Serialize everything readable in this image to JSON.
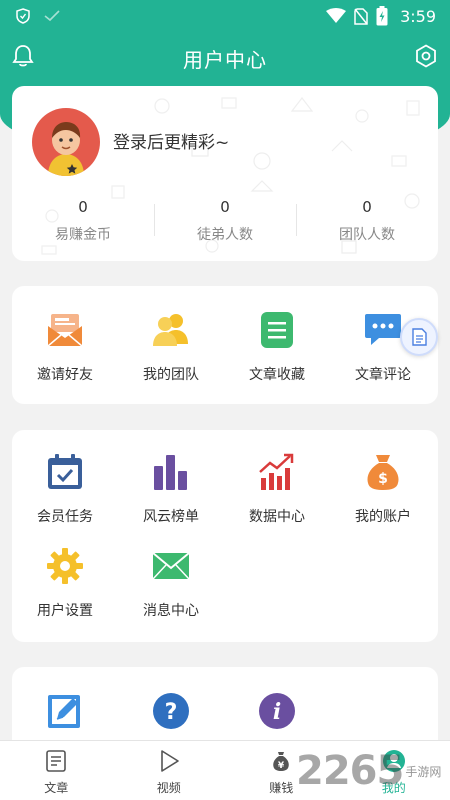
{
  "status_bar": {
    "time": "3:59",
    "icons": [
      "shield-icon",
      "check-icon",
      "wifi-icon",
      "no-sim-icon",
      "battery-charging-icon"
    ]
  },
  "header": {
    "title": "用户中心",
    "left_icon": "bell-icon",
    "right_icon": "settings-icon"
  },
  "profile": {
    "login_prompt": "登录后更精彩~",
    "stats": [
      {
        "value": "0",
        "label": "易赚金币"
      },
      {
        "value": "0",
        "label": "徒弟人数"
      },
      {
        "value": "0",
        "label": "团队人数"
      }
    ]
  },
  "menu_group_1": [
    {
      "label": "邀请好友",
      "icon": "invite-envelope-icon"
    },
    {
      "label": "我的团队",
      "icon": "team-icon"
    },
    {
      "label": "文章收藏",
      "icon": "collection-doc-icon"
    },
    {
      "label": "文章评论",
      "icon": "comment-icon"
    }
  ],
  "menu_group_2": [
    {
      "label": "会员任务",
      "icon": "calendar-task-icon"
    },
    {
      "label": "风云榜单",
      "icon": "ranking-bars-icon"
    },
    {
      "label": "数据中心",
      "icon": "data-chart-icon"
    },
    {
      "label": "我的账户",
      "icon": "money-bag-icon"
    },
    {
      "label": "用户设置",
      "icon": "gear-settings-icon"
    },
    {
      "label": "消息中心",
      "icon": "message-envelope-icon"
    }
  ],
  "menu_group_3": [
    {
      "icon": "edit-icon"
    },
    {
      "icon": "help-icon"
    },
    {
      "icon": "info-icon"
    }
  ],
  "bottom_nav": [
    {
      "label": "文章",
      "icon": "article-icon",
      "active": false
    },
    {
      "label": "视频",
      "icon": "video-play-icon",
      "active": false
    },
    {
      "label": "赚钱",
      "icon": "money-icon",
      "active": false
    },
    {
      "label": "我的",
      "icon": "user-icon",
      "active": true
    }
  ],
  "watermark": {
    "number": "2265",
    "text": "手游网"
  },
  "colors": {
    "primary": "#22b394",
    "avatar_bg": "#e45a4c",
    "orange": "#f08a3a",
    "yellow": "#f5c02b",
    "green": "#3db96f",
    "blue": "#3d8fe0",
    "navy": "#3a5f9a",
    "purple": "#6a4fa0",
    "red": "#d93b3b"
  }
}
